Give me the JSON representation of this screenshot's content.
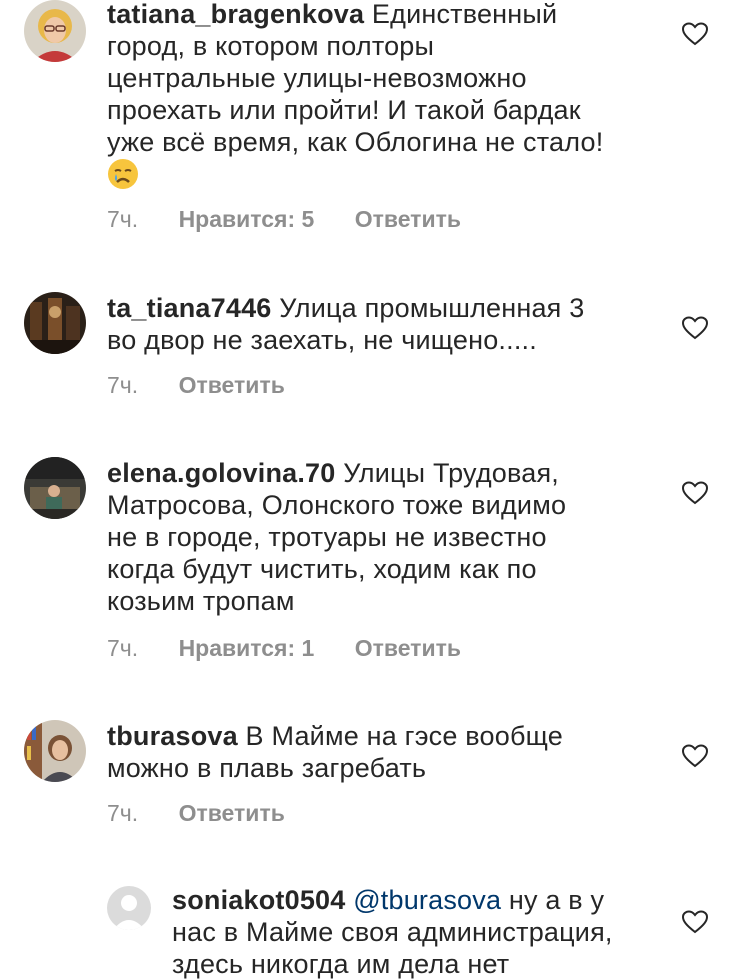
{
  "comments": [
    {
      "username": "tatiana_bragenkova",
      "text_lines": [
        "Единственный",
        "город, в котором полторы",
        "центральные улицы-невозможно",
        "проехать или пройти! И такой бардак",
        "уже всё время, как Облогина не стало!"
      ],
      "emoji_icon": "crying-face-icon",
      "time": "7ч.",
      "likes": "Нравится: 5",
      "reply": "Ответить"
    },
    {
      "username": "ta_tiana7446",
      "text_lines": [
        "Улица промышленная 3",
        "во двор не заехать, не чищено....."
      ],
      "time": "7ч.",
      "reply": "Ответить"
    },
    {
      "username": "elena.golovina.70",
      "text_lines": [
        "Улицы Трудовая,",
        "Матросова, Олонского тоже видимо",
        "не в городе, тротуары  не известно",
        "когда будут чистить, ходим как по",
        "козьим тропам"
      ],
      "time": "7ч.",
      "likes": "Нравится: 1",
      "reply": "Ответить"
    },
    {
      "username": "tburasova",
      "text_lines": [
        "В Майме на гэсе вообще",
        "можно в плавь загребать"
      ],
      "time": "7ч.",
      "reply": "Ответить"
    },
    {
      "username": "soniakot0504",
      "mention": "@tburasova",
      "text_lines": [
        "ну а в у",
        "нас в Майме своя администрация,",
        "здесь никогда им дела нет"
      ]
    }
  ],
  "colors": {
    "text": "#262626",
    "meta": "#8e8e8e",
    "mention": "#00376b"
  }
}
